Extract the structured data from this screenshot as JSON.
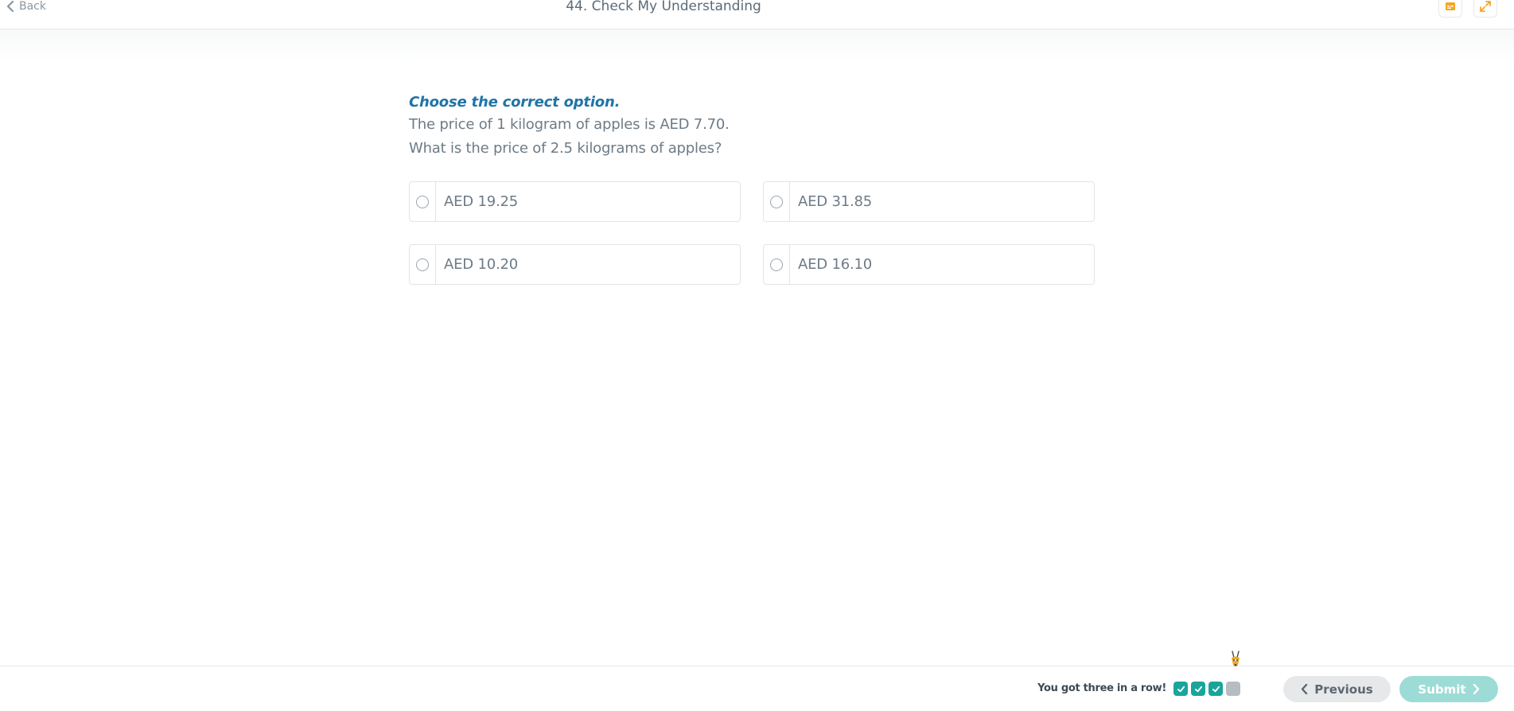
{
  "header": {
    "back_label": "Back",
    "title": "44. Check My Understanding",
    "tools": [
      {
        "icon": "captions-icon",
        "color": "#f5a623"
      },
      {
        "icon": "expand-icon",
        "color": "#f5a623"
      }
    ]
  },
  "question": {
    "instruction": "Choose the correct option.",
    "lines": [
      "The price of 1 kilogram of apples is AED 7.70.",
      "What is the price of 2.5 kilograms of apples?"
    ]
  },
  "options": [
    {
      "label": "AED 19.25",
      "selected": false
    },
    {
      "label": "AED 31.85",
      "selected": false
    },
    {
      "label": "AED 10.20",
      "selected": false
    },
    {
      "label": "AED 16.10",
      "selected": false
    }
  ],
  "footer": {
    "streak_text": "You got three in a row!",
    "streak": [
      true,
      true,
      true,
      false
    ],
    "previous_label": "Previous",
    "submit_label": "Submit"
  },
  "colors": {
    "instruction": "#1f74a8",
    "accent": "#19a59a",
    "submit_disabled": "#9ddcd6",
    "tool_icon": "#f5a623"
  }
}
